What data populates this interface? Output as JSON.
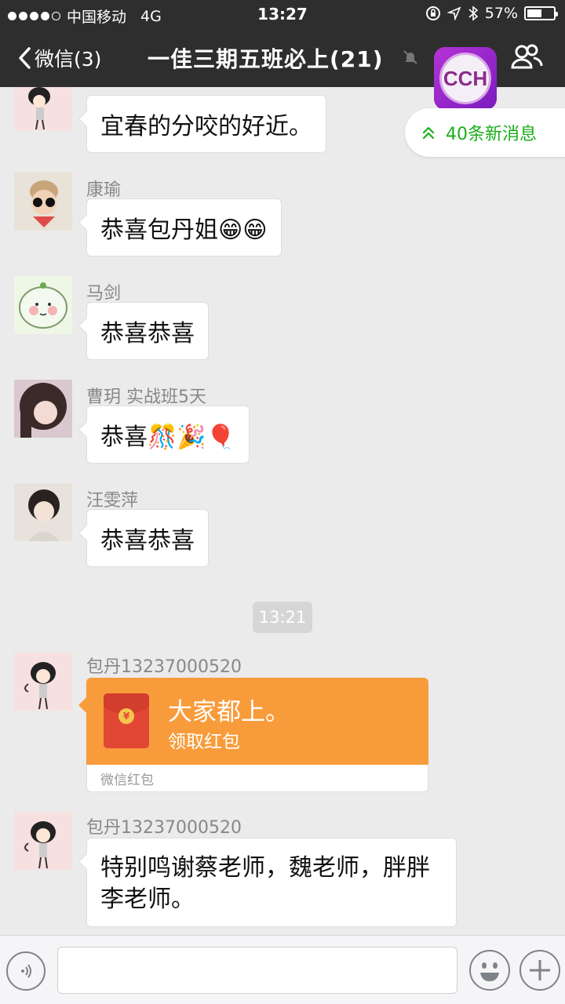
{
  "status_bar": {
    "carrier": "中国移动",
    "network": "4G",
    "time": "13:27",
    "battery_percent": "57%",
    "battery_level": 0.57
  },
  "nav": {
    "back_label": "微信(3)",
    "title": "一佳三期五班必上(21)",
    "mute_icon": "mute-bell-icon",
    "members_icon": "group-members-icon"
  },
  "floating_app": {
    "label": "CCH"
  },
  "new_messages": {
    "label": "40条新消息"
  },
  "messages": [
    {
      "sender": "",
      "text": "宜春的分咬的好近。"
    },
    {
      "sender": "康瑜",
      "text": "恭喜包丹姐😁😁"
    },
    {
      "sender": "马剑",
      "text": "恭喜恭喜"
    },
    {
      "sender": "曹玥 实战班5天",
      "text": "恭喜🎊🎉🎈"
    },
    {
      "sender": "汪雯萍",
      "text": "恭喜恭喜"
    }
  ],
  "timestamp": "13:21",
  "red_packet": {
    "sender": "包丹13237000520",
    "title": "大家都上。",
    "action": "领取红包",
    "footer": "微信红包",
    "coin_symbol": "¥"
  },
  "last_message": {
    "sender": "包丹13237000520",
    "text": "特别鸣谢蔡老师，魏老师，胖胖李老师。"
  },
  "input_bar": {
    "placeholder": "",
    "voice_icon": "voice-icon",
    "emoji_icon": "emoji-icon",
    "plus_icon": "plus-icon"
  },
  "colors": {
    "nav_bg": "#2e2e2e",
    "chat_bg": "#ebebeb",
    "accent_green": "#1aad19",
    "red_packet_orange": "#f89c3b"
  }
}
